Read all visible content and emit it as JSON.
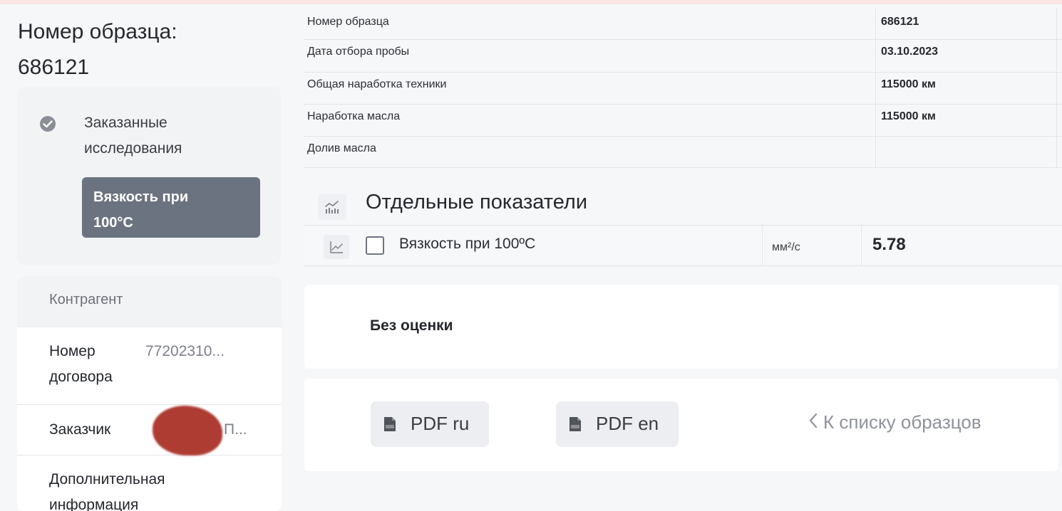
{
  "sample": {
    "title_line1": "Номер образца:",
    "title_line2": "686121"
  },
  "ordered_research": {
    "label_line1": "Заказанные",
    "label_line2": "исследования",
    "chip_text": "Вязкость при\n100°С"
  },
  "counterparty": {
    "header": "Контрагент",
    "contract_key_line1": "Номер",
    "contract_key_line2": "договора",
    "contract_value": "77202310...",
    "customer_key": "Заказчик",
    "customer_value": "П...",
    "extra_key_line1": "Дополнительная",
    "extra_key_line2": "информация"
  },
  "info_rows": [
    {
      "label": "Номер образца",
      "value": "686121"
    },
    {
      "label": "Дата отбора пробы",
      "value": "03.10.2023"
    },
    {
      "label": "Общая наработка техники",
      "value": "115000 км"
    },
    {
      "label": "Наработка масла",
      "value": "115000 км"
    },
    {
      "label": "Долив масла",
      "value": ""
    }
  ],
  "indicators": {
    "title": "Отдельные показатели",
    "row": {
      "name": "Вязкость при 100ºС",
      "unit": "мм²/с",
      "value": "5.78"
    }
  },
  "evaluation": {
    "text": "Без оценки"
  },
  "actions": {
    "pdf_ru": "PDF ru",
    "pdf_en": "PDF en",
    "back": "К списку образцов"
  },
  "icons": {
    "check": "check-circle-icon",
    "chart": "chart-icon",
    "graph": "line-graph-icon",
    "pdf": "pdf-file-icon",
    "back": "chevron-left-icon"
  },
  "colors": {
    "chip_bg": "#6c7380",
    "redaction": "#a82c22"
  }
}
